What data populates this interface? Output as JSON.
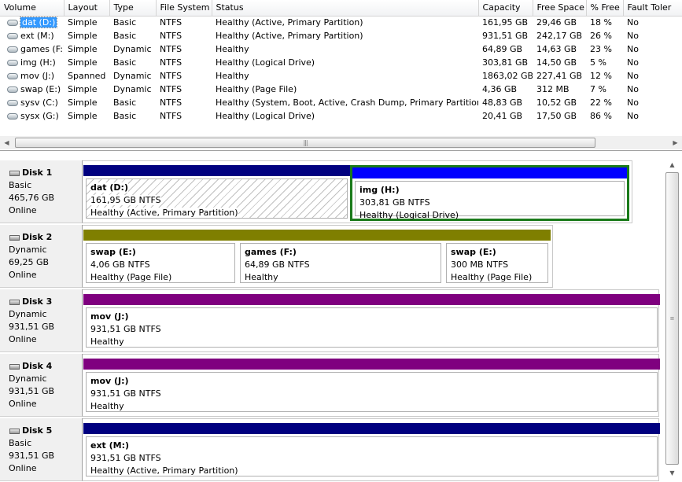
{
  "columns": [
    "Volume",
    "Layout",
    "Type",
    "File System",
    "Status",
    "Capacity",
    "Free Space",
    "% Free",
    "Fault Toler"
  ],
  "volumes": [
    {
      "name": "dat (D:)",
      "layout": "Simple",
      "type": "Basic",
      "fs": "NTFS",
      "status": "Healthy (Active, Primary Partition)",
      "capacity": "161,95 GB",
      "free": "29,46 GB",
      "pct": "18 %",
      "fault": "No"
    },
    {
      "name": "ext (M:)",
      "layout": "Simple",
      "type": "Basic",
      "fs": "NTFS",
      "status": "Healthy (Active, Primary Partition)",
      "capacity": "931,51 GB",
      "free": "242,17 GB",
      "pct": "26 %",
      "fault": "No"
    },
    {
      "name": "games (F:)",
      "layout": "Simple",
      "type": "Dynamic",
      "fs": "NTFS",
      "status": "Healthy",
      "capacity": "64,89 GB",
      "free": "14,63 GB",
      "pct": "23 %",
      "fault": "No"
    },
    {
      "name": "img (H:)",
      "layout": "Simple",
      "type": "Basic",
      "fs": "NTFS",
      "status": "Healthy (Logical Drive)",
      "capacity": "303,81 GB",
      "free": "14,50 GB",
      "pct": "5 %",
      "fault": "No"
    },
    {
      "name": "mov (J:)",
      "layout": "Spanned",
      "type": "Dynamic",
      "fs": "NTFS",
      "status": "Healthy",
      "capacity": "1863,02 GB",
      "free": "227,41 GB",
      "pct": "12 %",
      "fault": "No"
    },
    {
      "name": "swap (E:)",
      "layout": "Simple",
      "type": "Dynamic",
      "fs": "NTFS",
      "status": "Healthy (Page File)",
      "capacity": "4,36 GB",
      "free": "312 MB",
      "pct": "7 %",
      "fault": "No"
    },
    {
      "name": "sysv (C:)",
      "layout": "Simple",
      "type": "Basic",
      "fs": "NTFS",
      "status": "Healthy (System, Boot, Active, Crash Dump, Primary Partition)",
      "capacity": "48,83 GB",
      "free": "10,52 GB",
      "pct": "22 %",
      "fault": "No"
    },
    {
      "name": "sysx (G:)",
      "layout": "Simple",
      "type": "Basic",
      "fs": "NTFS",
      "status": "Healthy (Logical Drive)",
      "capacity": "20,41 GB",
      "free": "17,50 GB",
      "pct": "86 %",
      "fault": "No"
    }
  ],
  "hscroll": {
    "left_arrow": "◀",
    "right_arrow": "▶",
    "grip": "|||"
  },
  "vscroll": {
    "up_arrow": "▲",
    "down_arrow": "▼",
    "grip": "≡"
  },
  "colors": {
    "basic_primary": "#00007f",
    "logical": "#0000ff",
    "simple_dynamic": "#7f7f00",
    "spanned": "#7f007f",
    "selected_outline": "#1a7a1a"
  },
  "disks": [
    {
      "title": "Disk 1",
      "type": "Basic",
      "size": "465,76 GB",
      "state": "Online",
      "partitions": [
        {
          "name": "dat  (D:)",
          "size": "161,95 GB NTFS",
          "status": "Healthy (Active, Primary Partition)",
          "kind": "basic_primary"
        },
        {
          "name": "img  (H:)",
          "size": "303,81 GB NTFS",
          "status": "Healthy (Logical Drive)",
          "kind": "logical"
        }
      ]
    },
    {
      "title": "Disk 2",
      "type": "Dynamic",
      "size": "69,25 GB",
      "state": "Online",
      "partitions": [
        {
          "name": "swap  (E:)",
          "size": "4,06 GB NTFS",
          "status": "Healthy (Page File)",
          "kind": "simple_dynamic"
        },
        {
          "name": "games  (F:)",
          "size": "64,89 GB NTFS",
          "status": "Healthy",
          "kind": "simple_dynamic"
        },
        {
          "name": "swap  (E:)",
          "size": "300 MB NTFS",
          "status": "Healthy (Page File)",
          "kind": "simple_dynamic"
        }
      ]
    },
    {
      "title": "Disk 3",
      "type": "Dynamic",
      "size": "931,51 GB",
      "state": "Online",
      "partitions": [
        {
          "name": "mov  (J:)",
          "size": "931,51 GB NTFS",
          "status": "Healthy",
          "kind": "spanned"
        }
      ]
    },
    {
      "title": "Disk 4",
      "type": "Dynamic",
      "size": "931,51 GB",
      "state": "Online",
      "partitions": [
        {
          "name": "mov  (J:)",
          "size": "931,51 GB NTFS",
          "status": "Healthy",
          "kind": "spanned"
        }
      ]
    },
    {
      "title": "Disk 5",
      "type": "Basic",
      "size": "931,51 GB",
      "state": "Online",
      "partitions": [
        {
          "name": "ext  (M:)",
          "size": "931,51 GB NTFS",
          "status": "Healthy (Active, Primary Partition)",
          "kind": "basic_primary"
        }
      ]
    }
  ]
}
